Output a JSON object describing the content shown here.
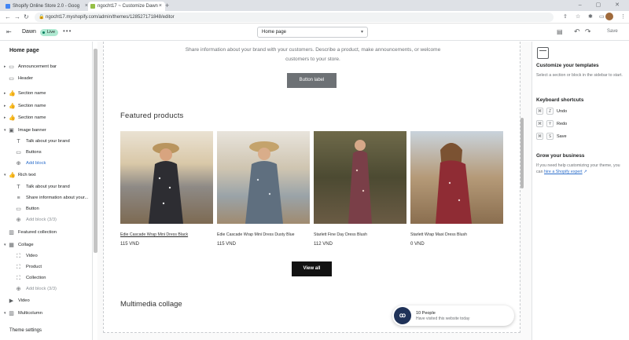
{
  "browser": {
    "tabs": [
      {
        "title": "Shopify Online Store 2.0 - Goog"
      },
      {
        "title": "ngocht17 ~ Customize Dawn ·"
      }
    ],
    "url": "ngocht17.myshopify.com/admin/themes/128527171848/editor"
  },
  "header": {
    "theme_name": "Dawn",
    "live_badge": "Live",
    "page_select": "Home page",
    "save_label": "Save"
  },
  "sidebar": {
    "title": "Home page",
    "items": [
      {
        "label": "Announcement bar"
      },
      {
        "label": "Header"
      },
      {
        "label": "Section name"
      },
      {
        "label": "Section name"
      },
      {
        "label": "Section name"
      },
      {
        "label": "Image banner"
      },
      {
        "label": "Talk about your brand"
      },
      {
        "label": "Buttons"
      },
      {
        "label": "Add block"
      },
      {
        "label": "Rich text"
      },
      {
        "label": "Talk about your brand"
      },
      {
        "label": "Share information about your..."
      },
      {
        "label": "Button"
      },
      {
        "label": "Add block (3/3)"
      },
      {
        "label": "Featured collection"
      },
      {
        "label": "Collage"
      },
      {
        "label": "Video"
      },
      {
        "label": "Product"
      },
      {
        "label": "Collection"
      },
      {
        "label": "Add block (3/3)"
      },
      {
        "label": "Video"
      },
      {
        "label": "Multicolumn"
      }
    ],
    "theme_settings": "Theme settings"
  },
  "preview": {
    "rich_text_description": "Share information about your brand with your customers. Describe a product, make announcements, or welcome customers to your store.",
    "rich_text_button": "Button label",
    "featured_heading": "Featured products",
    "products": [
      {
        "name": "Edie Cascade Wrap Mini Dress Black",
        "price": "115 VND"
      },
      {
        "name": "Edie Cascade Wrap Mini Dress Dusty Blue",
        "price": "115 VND"
      },
      {
        "name": "Starlett Fine Day Dress Blush",
        "price": "112 VND"
      },
      {
        "name": "Starlett Wrap Maxi Dress Blush",
        "price": "0 VND"
      }
    ],
    "view_all": "View all",
    "multimedia_heading": "Multimedia collage"
  },
  "popup": {
    "title": "10 People",
    "subtitle": "Have visited this website today"
  },
  "right_panel": {
    "customize_title": "Customize your templates",
    "customize_text": "Select a section or block in the sidebar to start.",
    "shortcuts_title": "Keyboard shortcuts",
    "shortcuts": [
      {
        "key": "Z",
        "action": "Undo"
      },
      {
        "key": "Y",
        "action": "Redo"
      },
      {
        "key": "S",
        "action": "Save"
      }
    ],
    "grow_title": "Grow your business",
    "grow_text": "If you need help customizing your theme, you can",
    "grow_link": "hire a Shopify expert"
  },
  "colors": {
    "live_badge": "#aee9d1",
    "button_dark": "#121212",
    "link": "#2c6ecb"
  }
}
